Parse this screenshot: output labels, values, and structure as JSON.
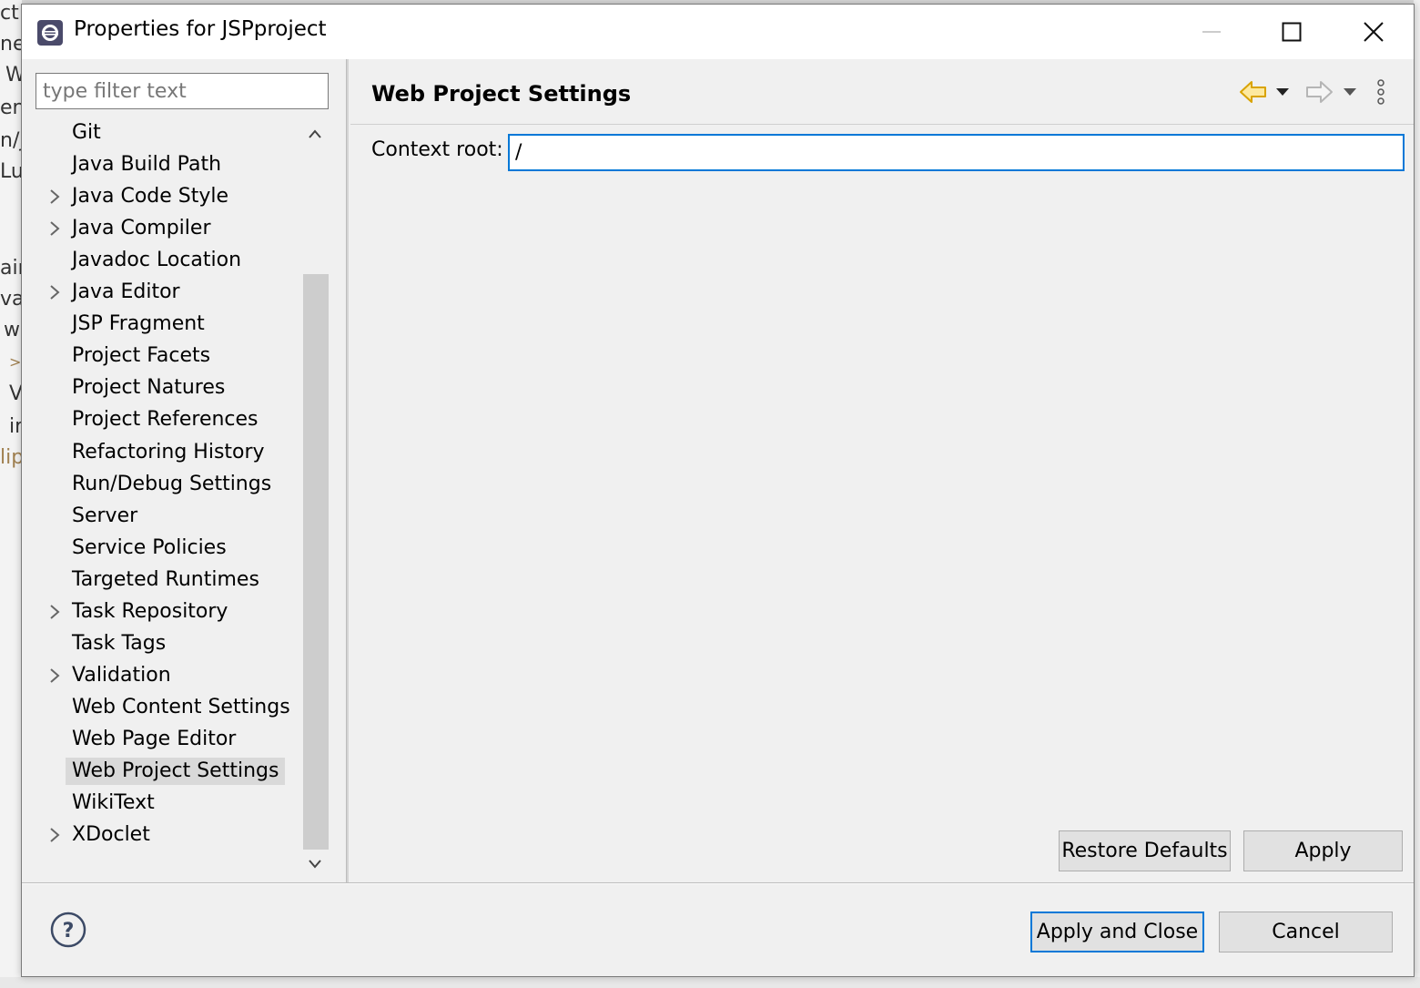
{
  "window": {
    "title": "Properties for JSPproject",
    "controls": [
      "minimize-icon",
      "maximize-icon",
      "close-icon"
    ]
  },
  "filter": {
    "placeholder": "type filter text",
    "value": ""
  },
  "tree": {
    "items": [
      {
        "label": "Git",
        "expandable": false,
        "selected": false
      },
      {
        "label": "Java Build Path",
        "expandable": false,
        "selected": false
      },
      {
        "label": "Java Code Style",
        "expandable": true,
        "selected": false
      },
      {
        "label": "Java Compiler",
        "expandable": true,
        "selected": false
      },
      {
        "label": "Javadoc Location",
        "expandable": false,
        "selected": false
      },
      {
        "label": "Java Editor",
        "expandable": true,
        "selected": false
      },
      {
        "label": "JSP Fragment",
        "expandable": false,
        "selected": false
      },
      {
        "label": "Project Facets",
        "expandable": false,
        "selected": false
      },
      {
        "label": "Project Natures",
        "expandable": false,
        "selected": false
      },
      {
        "label": "Project References",
        "expandable": false,
        "selected": false
      },
      {
        "label": "Refactoring History",
        "expandable": false,
        "selected": false
      },
      {
        "label": "Run/Debug Settings",
        "expandable": false,
        "selected": false
      },
      {
        "label": "Server",
        "expandable": false,
        "selected": false
      },
      {
        "label": "Service Policies",
        "expandable": false,
        "selected": false
      },
      {
        "label": "Targeted Runtimes",
        "expandable": false,
        "selected": false
      },
      {
        "label": "Task Repository",
        "expandable": true,
        "selected": false
      },
      {
        "label": "Task Tags",
        "expandable": false,
        "selected": false
      },
      {
        "label": "Validation",
        "expandable": true,
        "selected": false
      },
      {
        "label": "Web Content Settings",
        "expandable": false,
        "selected": false
      },
      {
        "label": "Web Page Editor",
        "expandable": false,
        "selected": false
      },
      {
        "label": "Web Project Settings",
        "expandable": false,
        "selected": true
      },
      {
        "label": "WikiText",
        "expandable": false,
        "selected": false
      },
      {
        "label": "XDoclet",
        "expandable": true,
        "selected": false
      }
    ]
  },
  "page": {
    "title": "Web Project Settings",
    "context_root_label": "Context root:",
    "context_root_value": "/"
  },
  "buttons": {
    "restore_defaults": "Restore Defaults",
    "apply": "Apply",
    "apply_and_close": "Apply and Close",
    "cancel": "Cancel"
  },
  "background": {
    "left_fragments": [
      "ct",
      "ne",
      "W",
      "en",
      "n/j",
      "Lu",
      "ain",
      "va",
      "w",
      ">",
      "V",
      "ir",
      "lip"
    ]
  },
  "colors": {
    "accent": "#0078d7",
    "back_arrow": "#e8b400",
    "selection": "#d9d9d9"
  }
}
